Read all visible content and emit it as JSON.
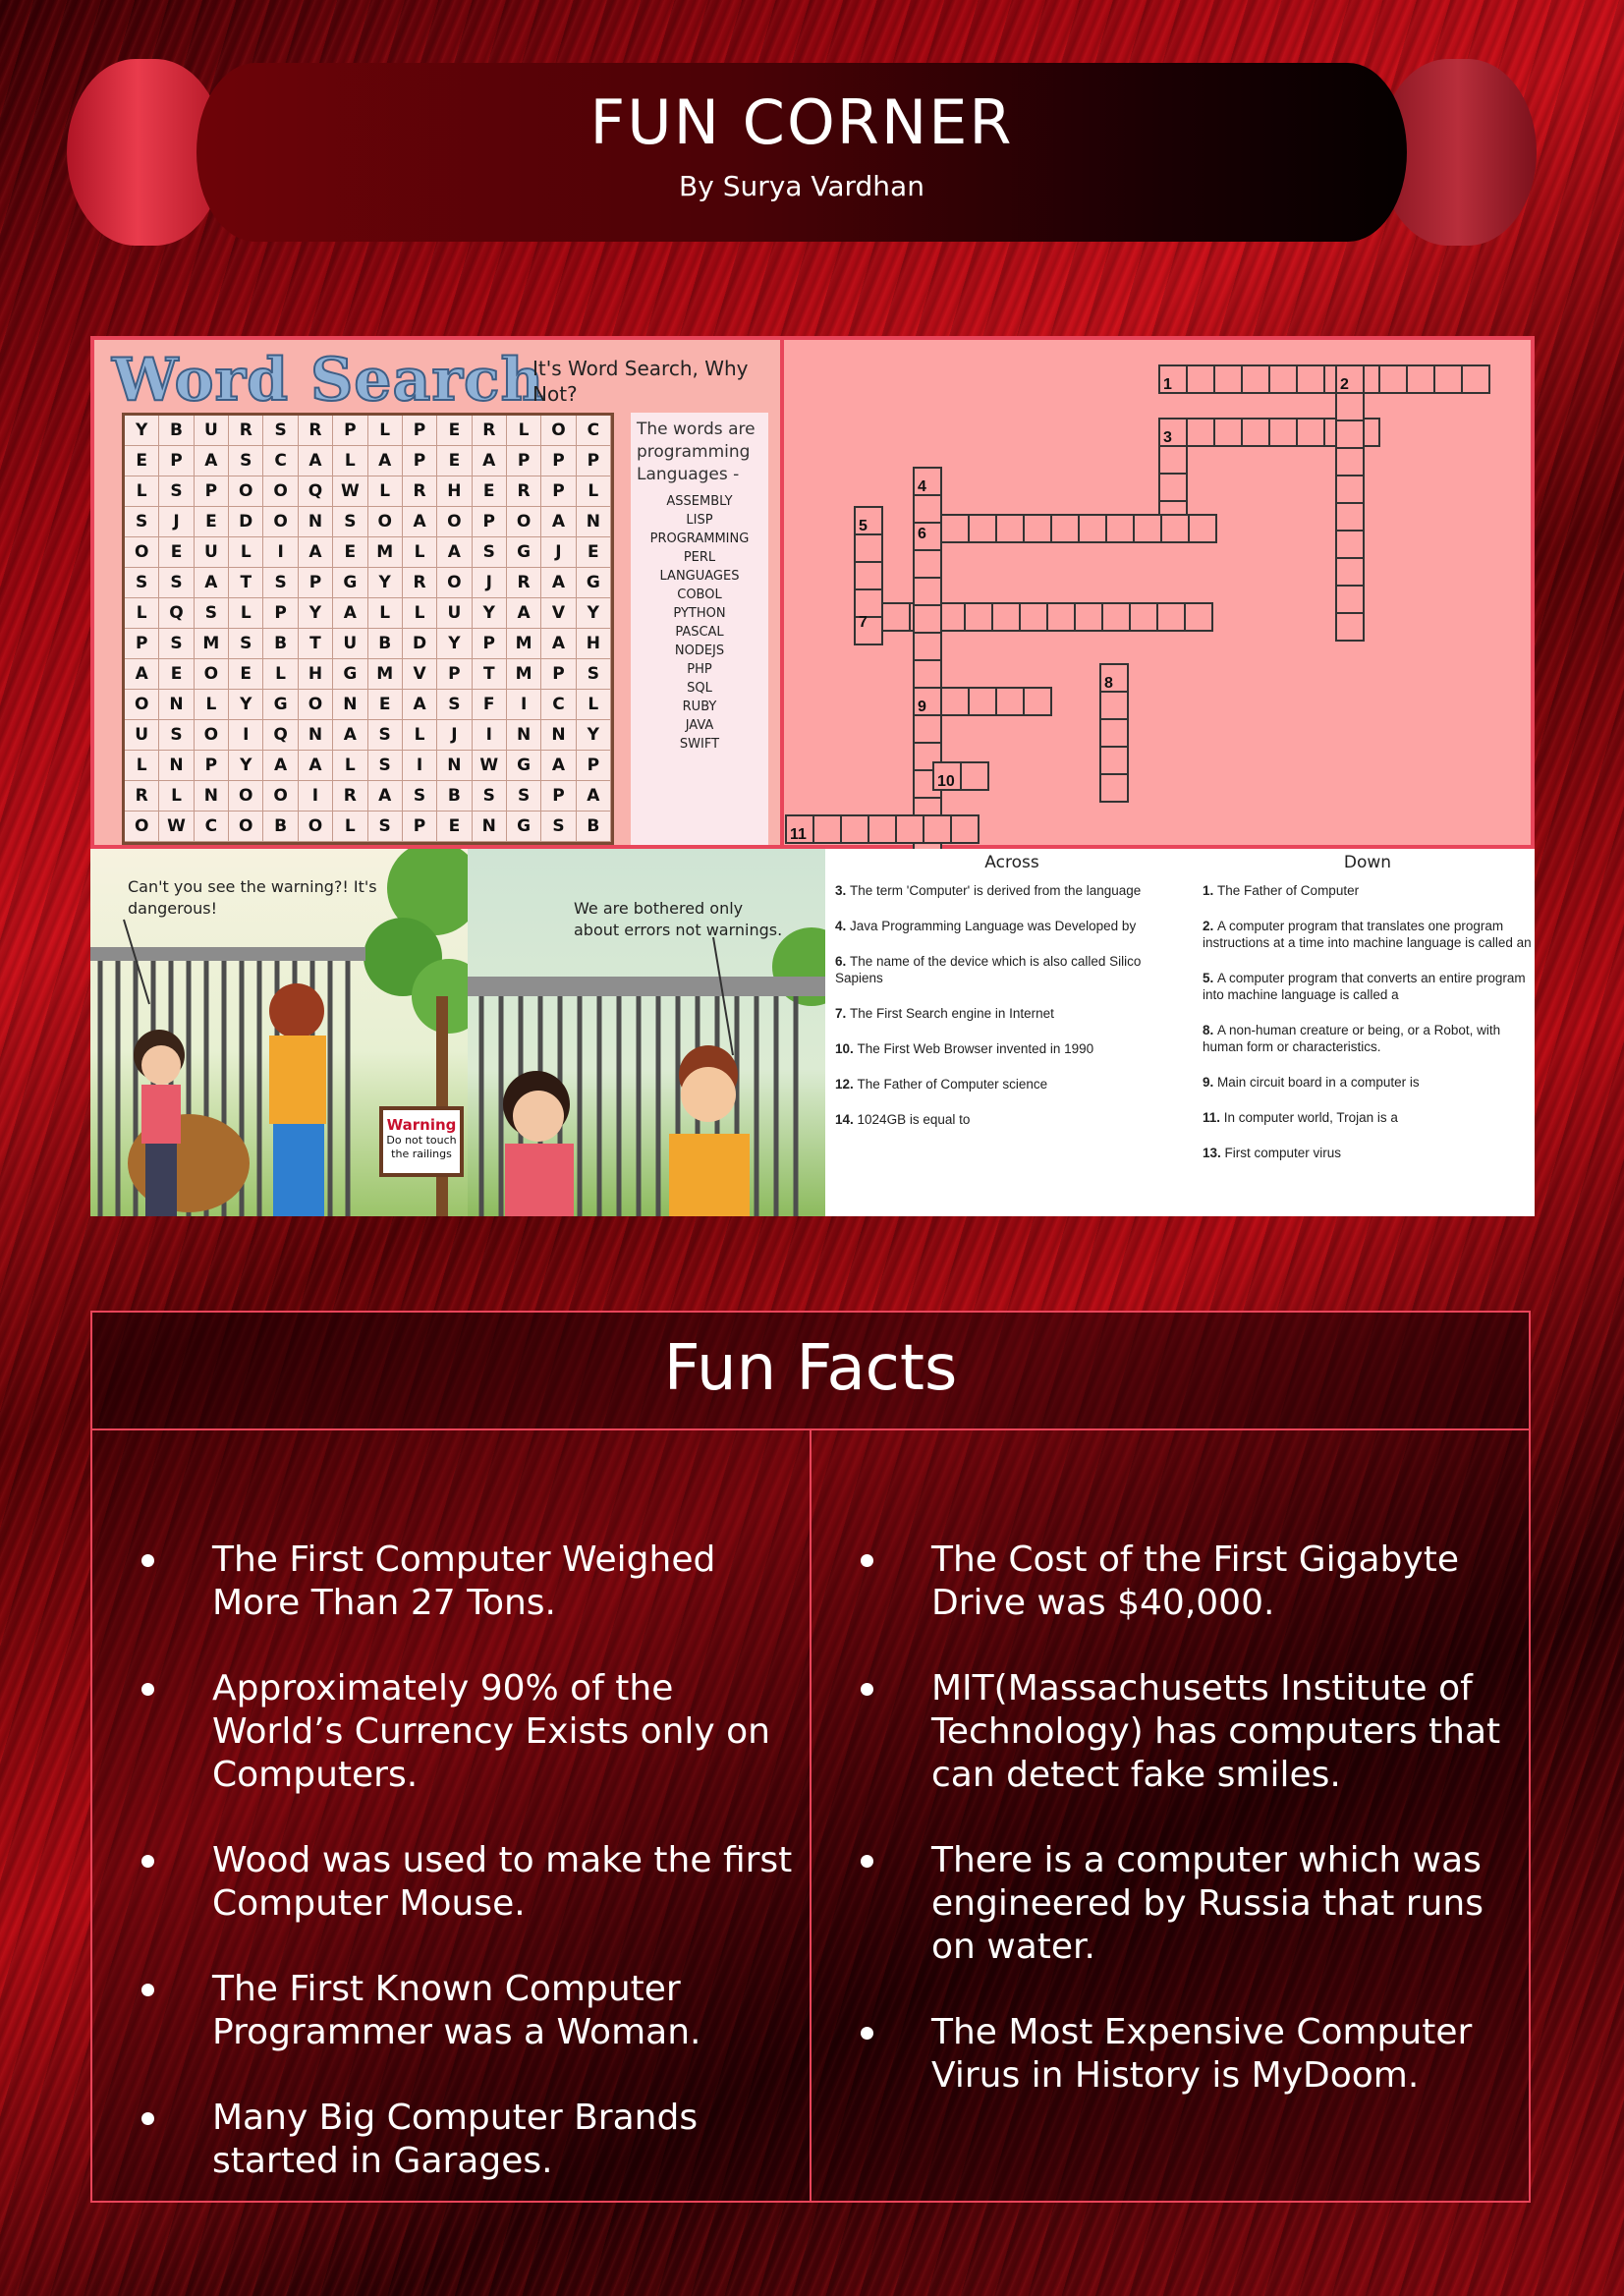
{
  "header": {
    "title": "FUN CORNER",
    "byline": "By Surya Vardhan"
  },
  "word_search": {
    "title": "Word Search",
    "subtitle": "It's Word Search, Why Not?",
    "grid": [
      "YBURSRPLPERLOC",
      "EPASCALAPEAPPP",
      "LSPOOQWLRHERPL",
      "SJEDONSOAOPOAN",
      "OEULIAEMLASGJE",
      "SSATSPGYROJRAG",
      "LQSLPYALLUYAVY",
      "PSMSBTUBDYPMAH",
      "AEOELHGMVPTMPS",
      "ONLYGONEASFICL",
      "USOIQNASLJINNY",
      "LNPYAALSINWGAP",
      "RLNOOIRASBSSPA",
      "OWCOBOLSPENGSB"
    ],
    "words_heading": "The words are programming Languages -",
    "words": [
      "ASSEMBLY",
      "LISP",
      "PROGRAMMING",
      "PERL",
      "LANGUAGES",
      "COBOL",
      "PYTHON",
      "PASCAL",
      "NODEJS",
      "PHP",
      "SQL",
      "RUBY",
      "JAVA",
      "SWIFT"
    ]
  },
  "crossword": {
    "numbers": [
      "1",
      "2",
      "3",
      "4",
      "5",
      "6",
      "7",
      "8",
      "9",
      "10",
      "11"
    ]
  },
  "comic": {
    "bubble_left": "Can't you see the warning?! It's dangerous!",
    "bubble_right": "We are bothered only about errors not warnings.",
    "sign_title": "Warning",
    "sign_text": "Do not touch the railings"
  },
  "clues": {
    "across_heading": "Across",
    "down_heading": "Down",
    "across": [
      {
        "num": "3.",
        "text": "The term 'Computer' is derived from the language"
      },
      {
        "num": "4.",
        "text": "Java Programming Language was Developed by"
      },
      {
        "num": "6.",
        "text": "The name of the device which is also called Silico Sapiens"
      },
      {
        "num": "7.",
        "text": "The First Search engine in Internet"
      },
      {
        "num": "10.",
        "text": "The First Web Browser invented in 1990"
      },
      {
        "num": "12.",
        "text": "The Father of Computer science"
      },
      {
        "num": "14.",
        "text": "1024GB is equal to"
      }
    ],
    "down": [
      {
        "num": "1.",
        "text": "The Father of Computer"
      },
      {
        "num": "2.",
        "text": "A computer program that translates one program instructions at a time into machine language is called an"
      },
      {
        "num": "5.",
        "text": "A computer program that converts an entire program into machine language is called a"
      },
      {
        "num": "8.",
        "text": "A non-human creature or being, or a Robot, with human form or characteristics."
      },
      {
        "num": "9.",
        "text": "Main circuit board in a computer is"
      },
      {
        "num": "11.",
        "text": "In computer world, Trojan is a"
      },
      {
        "num": "13.",
        "text": "First computer virus"
      }
    ]
  },
  "fun_facts": {
    "title": "Fun Facts",
    "left": [
      "The First Computer Weighed More Than 27 Tons.",
      "Approximately 90% of the World’s Currency Exists only on Computers.",
      "Wood was used to make the first Computer Mouse.",
      "The First Known Computer Programmer was a Woman.",
      "Many Big Computer Brands started in Garages."
    ],
    "right": [
      "The Cost of the First Gigabyte Drive was $40,000.",
      "MIT(Massachusetts Institute of Technology) has computers that can detect fake smiles.",
      "There is a computer which was engineered by Russia that runs on water.",
      "The Most Expensive Computer Virus in History is MyDoom."
    ]
  },
  "colors": {
    "accent_border": "#e8455a",
    "crossword_bg": "#fda4a4",
    "wordsearch_bg": "#f9b3ad"
  }
}
